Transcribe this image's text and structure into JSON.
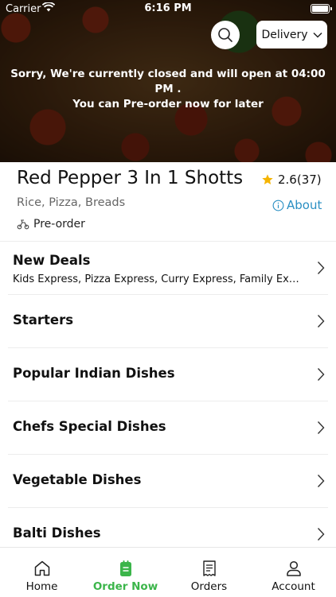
{
  "status_bar": {
    "carrier": "Carrier",
    "time": "6:16 PM"
  },
  "header": {
    "delivery_label": "Delivery",
    "closed_message_line1": "Sorry, We're currently closed and will open at 04:00 PM .",
    "closed_message_line2": "You can Pre-order now for later"
  },
  "restaurant": {
    "name": "Red Pepper 3 In 1 Shotts",
    "rating": "2.6(37)",
    "cuisine": "Rice, Pizza, Breads",
    "about_label": "About",
    "order_mode": "Pre-order"
  },
  "menu": [
    {
      "title": "New Deals",
      "subtitle": "Kids Express, Pizza Express, Curry Express, Family Exp..."
    },
    {
      "title": "Starters",
      "subtitle": ""
    },
    {
      "title": "Popular Indian Dishes",
      "subtitle": ""
    },
    {
      "title": "Chefs Special Dishes",
      "subtitle": ""
    },
    {
      "title": "Vegetable Dishes",
      "subtitle": ""
    },
    {
      "title": "Balti Dishes",
      "subtitle": ""
    }
  ],
  "tabs": [
    {
      "label": "Home",
      "icon": "home-icon"
    },
    {
      "label": "Order Now",
      "icon": "order-icon"
    },
    {
      "label": "Orders",
      "icon": "receipt-icon"
    },
    {
      "label": "Account",
      "icon": "account-icon"
    }
  ],
  "colors": {
    "accent_green": "#3bb54a",
    "link_blue": "#2a8fc3",
    "star": "#f5b400"
  }
}
